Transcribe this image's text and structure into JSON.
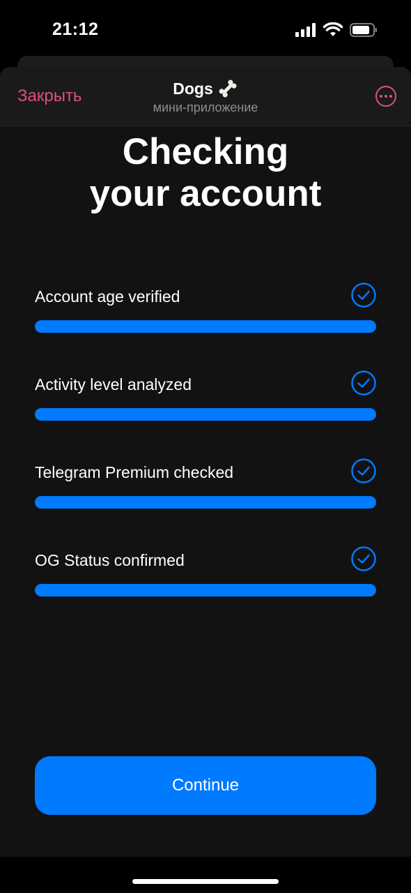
{
  "status_bar": {
    "time": "21:12",
    "icons": [
      "signal-icon",
      "wifi-icon",
      "battery-icon"
    ]
  },
  "header": {
    "close_label": "Закрыть",
    "title": "Dogs",
    "title_emoji": "🦴",
    "subtitle": "мини-приложение",
    "more_icon": "more-icon"
  },
  "main": {
    "title_line1": "Checking",
    "title_line2": "your account",
    "checks": [
      {
        "label": "Account age verified",
        "progress": 1.0,
        "status": "checked"
      },
      {
        "label": "Activity level analyzed",
        "progress": 1.0,
        "status": "checked"
      },
      {
        "label": "Telegram Premium checked",
        "progress": 1.0,
        "status": "checked"
      },
      {
        "label": "OG Status confirmed",
        "progress": 1.0,
        "status": "checked"
      }
    ],
    "continue_label": "Continue"
  },
  "colors": {
    "accent": "#007aff",
    "close": "#e0507a",
    "background": "#121212"
  }
}
